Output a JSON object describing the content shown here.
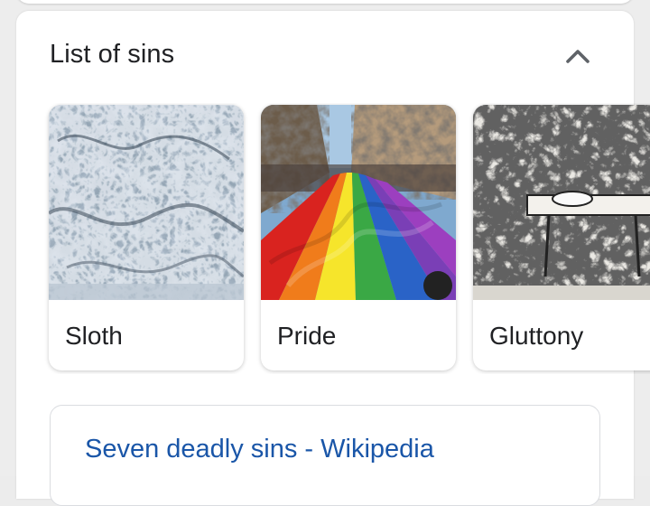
{
  "section": {
    "title": "List of sins",
    "collapse_icon": "chevron-up-icon"
  },
  "cards": [
    {
      "label": "Sloth",
      "image": "engraving-of-sloth"
    },
    {
      "label": "Pride",
      "image": "rainbow-flag-parade"
    },
    {
      "label": "Gluttony",
      "image": "woodcut-of-gluttony"
    }
  ],
  "result": {
    "title": "Seven deadly sins - Wikipedia"
  },
  "colors": {
    "link": "#1a56a8",
    "text": "#202124",
    "background": "#ededed"
  }
}
